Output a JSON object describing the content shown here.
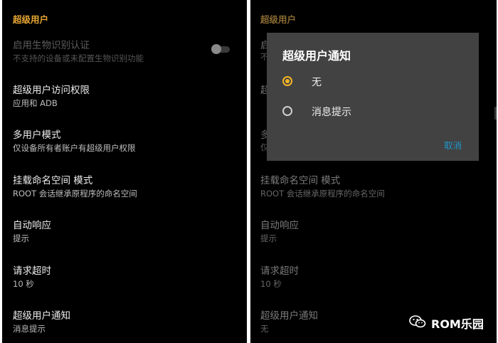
{
  "left": {
    "section_header": "超级用户",
    "items": [
      {
        "title": "启用生物识别认证",
        "subtitle": "不支持的设备或未配置生物识别功能"
      },
      {
        "title": "超级用户访问权限",
        "subtitle": "应用和 ADB"
      },
      {
        "title": "多用户模式",
        "subtitle": "仅设备所有者账户有超级用户权限"
      },
      {
        "title": "挂载命名空间 模式",
        "subtitle": "ROOT 会话继承原程序的命名空间"
      },
      {
        "title": "自动响应",
        "subtitle": "提示"
      },
      {
        "title": "请求超时",
        "subtitle": "10 秒"
      },
      {
        "title": "超级用户通知",
        "subtitle": "消息提示"
      }
    ]
  },
  "right": {
    "section_header": "超级用户",
    "items": [
      {
        "title": "挂载命名空间 模式",
        "subtitle": "ROOT 会话继承原程序的命名空间"
      },
      {
        "title": "自动响应",
        "subtitle": "提示"
      },
      {
        "title": "请求超时",
        "subtitle": "10 秒"
      },
      {
        "title": "超级用户通知",
        "subtitle": "无"
      }
    ],
    "partial_letters": [
      "启",
      "不",
      "超",
      "多",
      "仅"
    ],
    "dialog": {
      "title": "超级用户通知",
      "options": [
        "无",
        "消息提示"
      ],
      "selected_index": 0,
      "cancel_label": "取消"
    }
  },
  "watermark": {
    "text": "ROM乐园",
    "icon": "wechat-icon"
  },
  "colors": {
    "accent": "#F5B526",
    "header": "#E7A733",
    "link": "#2196C9",
    "background": "#000000",
    "dialog": "#424242"
  }
}
